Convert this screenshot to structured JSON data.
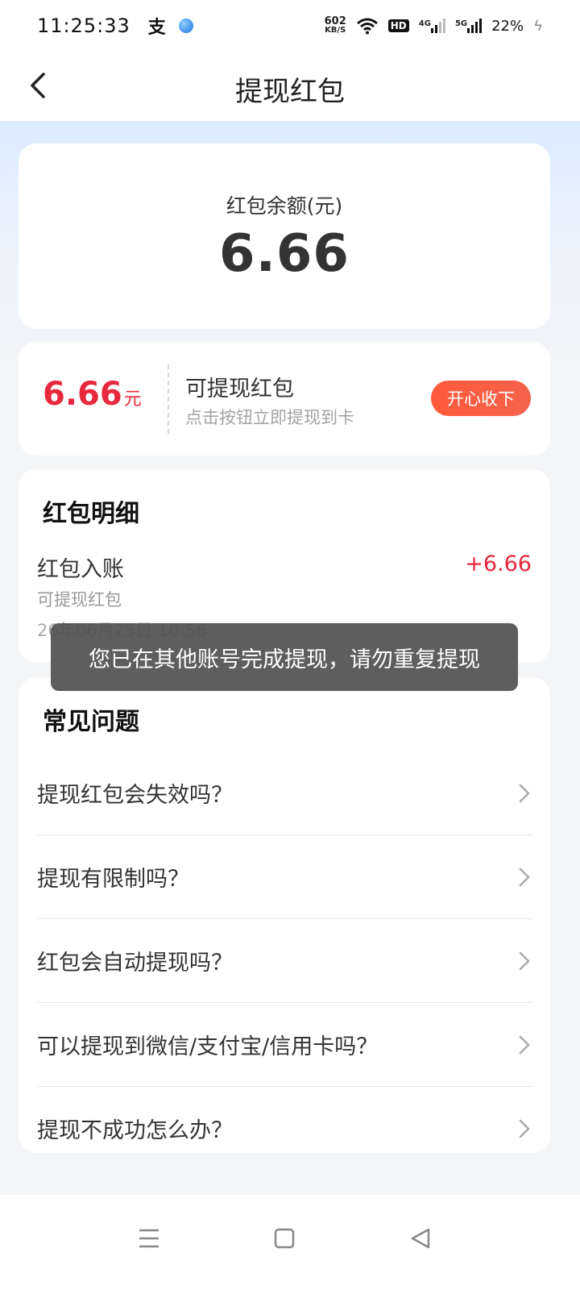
{
  "status_bar": {
    "time": "11:25:33",
    "app_icon_1": "支",
    "net_speed_value": "602",
    "net_speed_unit": "KB/S",
    "hd": "HD",
    "network_1": "4G",
    "network_2": "5G",
    "battery": "22%"
  },
  "header": {
    "title": "提现红包"
  },
  "balance": {
    "label": "红包余额(元)",
    "amount": "6.66"
  },
  "withdraw": {
    "amount": "6.66",
    "unit": "元",
    "title": "可提现红包",
    "subtitle": "点击按钮立即提现到卡",
    "button_label": "开心收下"
  },
  "detail": {
    "heading": "红包明细",
    "record": {
      "name": "红包入账",
      "amount": "+6.66",
      "type": "可提现红包",
      "time": "26年06月25日 10:56"
    }
  },
  "toast": {
    "message": "您已在其他账号完成提现，请勿重复提现"
  },
  "faq": {
    "heading": "常见问题",
    "items": [
      {
        "question": "提现红包会失效吗？"
      },
      {
        "question": "提现有限制吗？"
      },
      {
        "question": "红包会自动提现吗？"
      },
      {
        "question": "可以提现到微信/支付宝/信用卡吗？"
      },
      {
        "question": "提现不成功怎么办？"
      }
    ]
  },
  "colors": {
    "accent_red": "#e8283c",
    "button_orange": "#ff5a3c",
    "header_gradient": "#dcebff"
  },
  "icons": {
    "back": "chevron-left-icon",
    "faq_arrow": "chevron-right-icon",
    "nav_menu": "menu-icon",
    "nav_home": "square-home-icon",
    "nav_back": "triangle-back-icon"
  }
}
